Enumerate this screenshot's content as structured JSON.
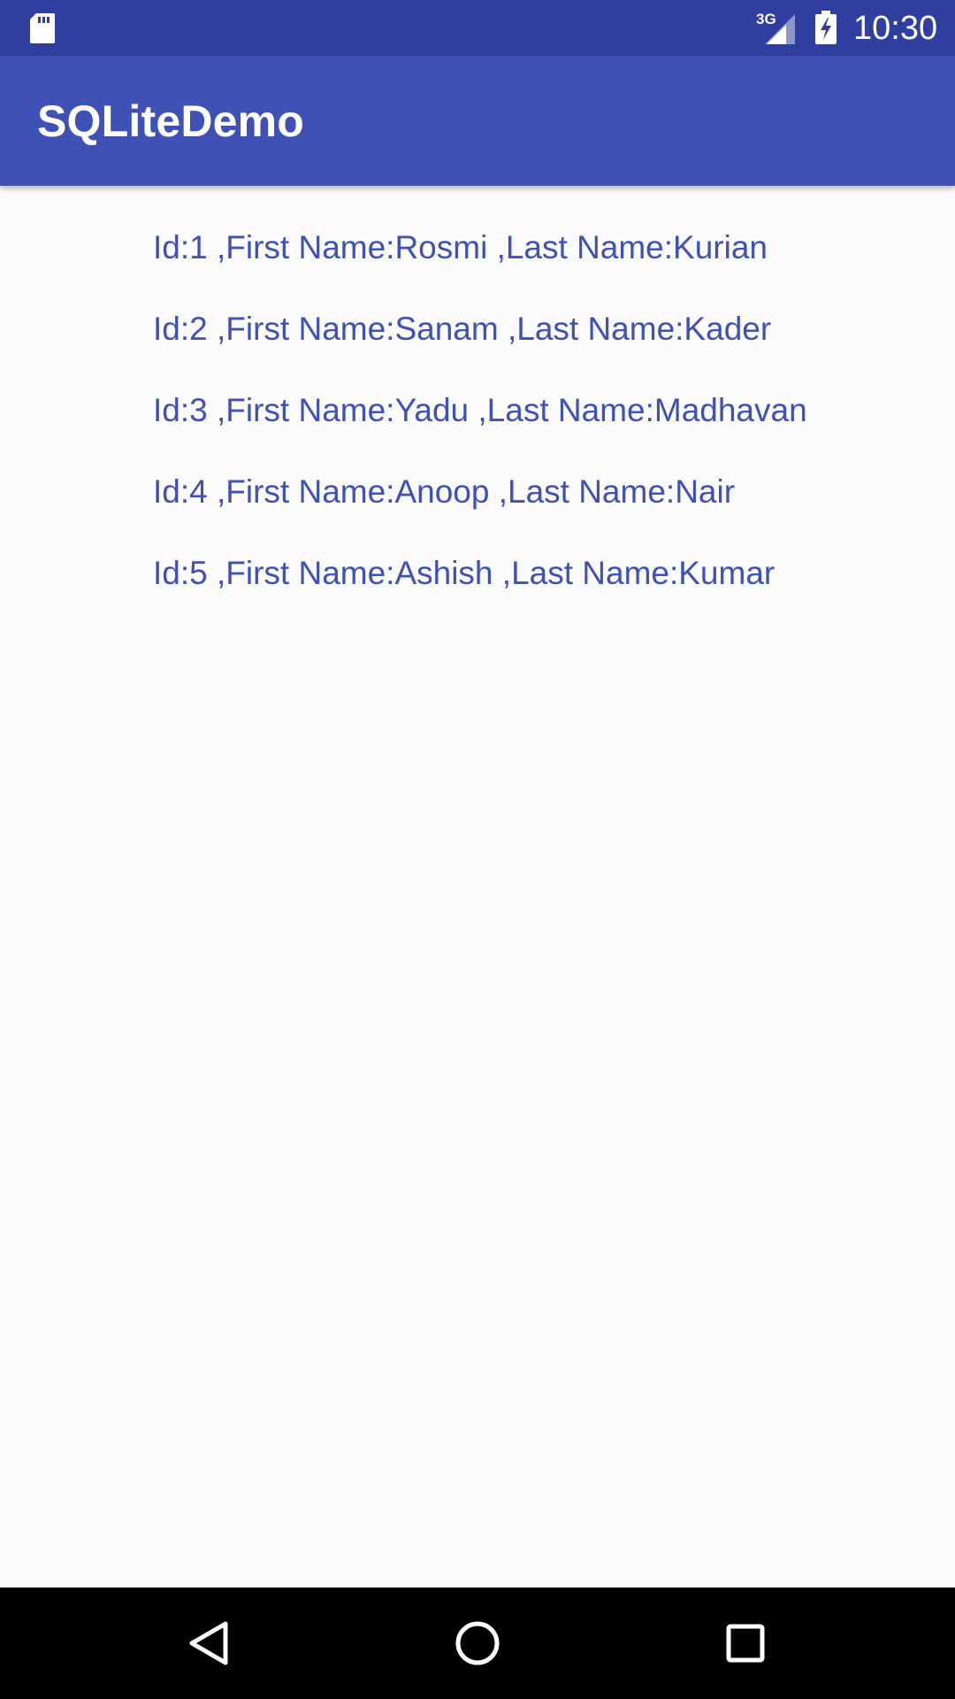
{
  "status_bar": {
    "network_type": "3G",
    "time": "10:30",
    "icons": [
      "sd-card-icon",
      "signal-icon",
      "battery-charging-icon"
    ]
  },
  "app_bar": {
    "title": "SQLiteDemo"
  },
  "records": [
    "Id:1 ,First Name:Rosmi ,Last Name:Kurian",
    "Id:2 ,First Name:Sanam ,Last Name:Kader",
    "Id:3 ,First Name:Yadu ,Last Name:Madhavan",
    "Id:4 ,First Name:Anoop ,Last Name:Nair",
    "Id:5 ,First Name:Ashish ,Last Name:Kumar"
  ],
  "nav_bar": {
    "icons": [
      "back-icon",
      "home-icon",
      "recents-icon"
    ]
  },
  "colors": {
    "status_bar": "#303f9f",
    "primary": "#3f51b5",
    "text_accent": "#3f51b5",
    "background": "#fafafa",
    "nav_bar": "#000000"
  }
}
